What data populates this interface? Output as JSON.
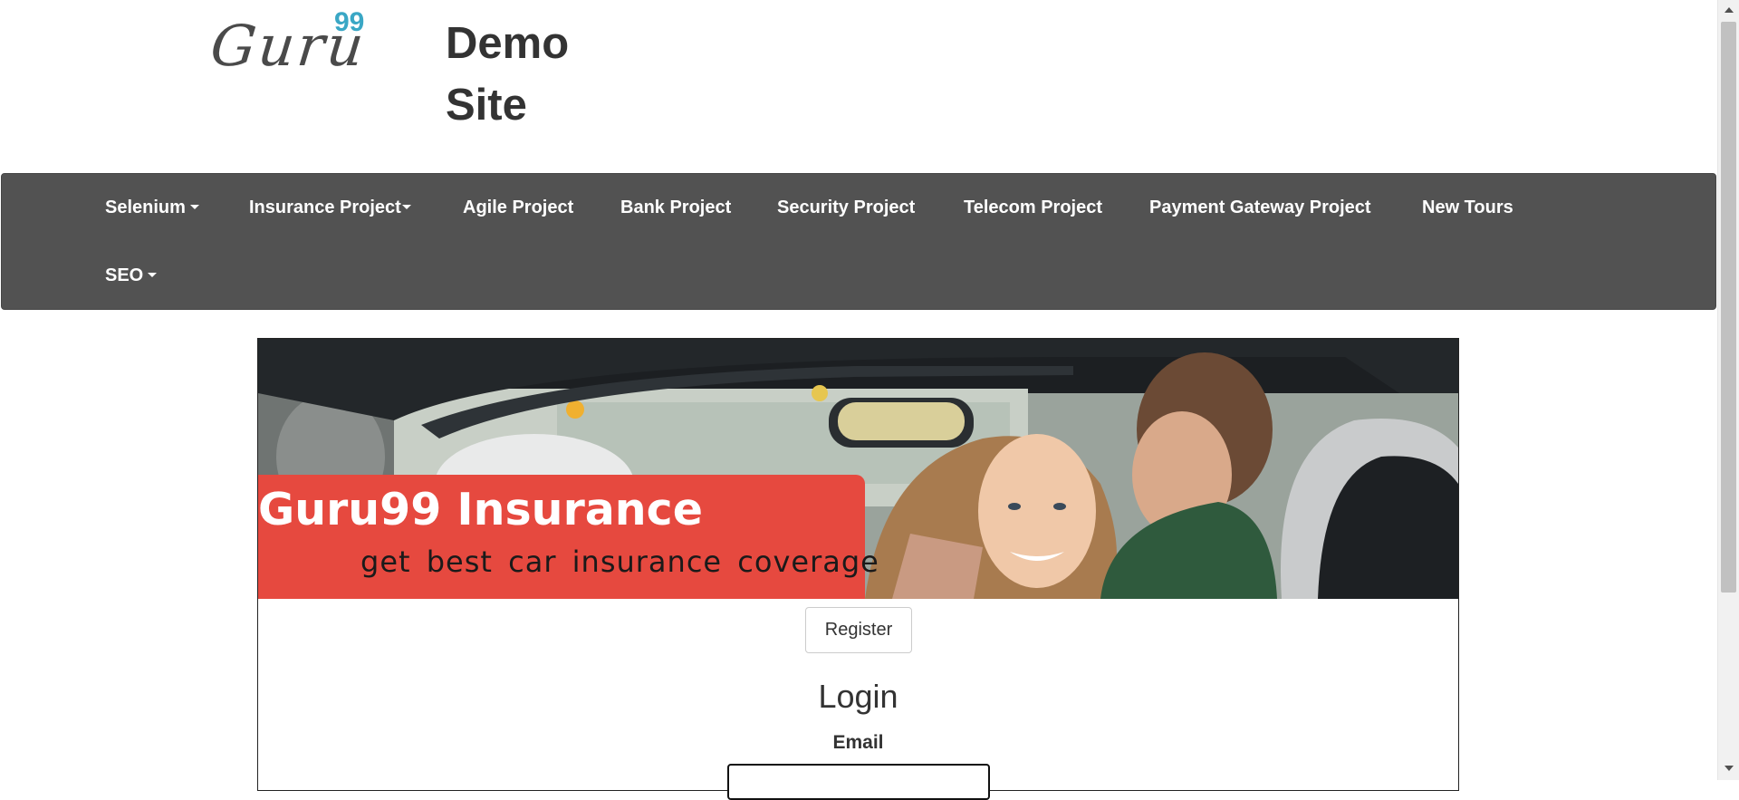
{
  "header": {
    "logo_text": "Guru",
    "logo_superscript": "99",
    "site_title_line1": "Demo",
    "site_title_line2": "Site"
  },
  "navbar": {
    "items": [
      {
        "label": "Selenium",
        "dropdown": true
      },
      {
        "label": "Insurance Project",
        "dropdown": true
      },
      {
        "label": "Agile Project",
        "dropdown": false
      },
      {
        "label": "Bank Project",
        "dropdown": false
      },
      {
        "label": "Security Project",
        "dropdown": false
      },
      {
        "label": "Telecom Project",
        "dropdown": false
      },
      {
        "label": "Payment Gateway Project",
        "dropdown": false
      },
      {
        "label": "New Tours",
        "dropdown": false
      },
      {
        "label": "SEO",
        "dropdown": true
      }
    ]
  },
  "banner": {
    "title": "Guru99 Insurance",
    "subtitle": "get best car insurance coverage"
  },
  "main": {
    "register_label": "Register",
    "login_heading": "Login",
    "email_label": "Email",
    "email_value": ""
  },
  "colors": {
    "navbar_bg": "#525252",
    "banner_red": "#e6493f",
    "logo_accent": "#3aa7c5"
  }
}
